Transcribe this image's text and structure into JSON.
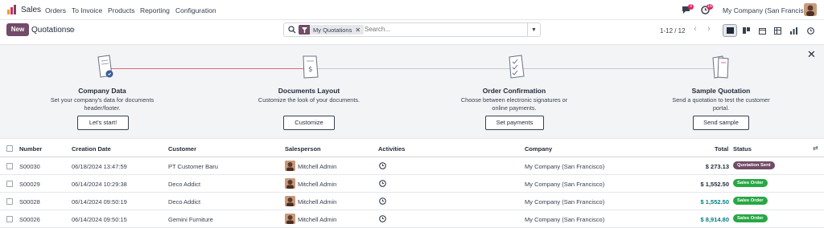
{
  "navbar": {
    "app_name": "Sales",
    "menu": [
      "Orders",
      "To Invoice",
      "Products",
      "Reporting",
      "Configuration"
    ],
    "chat_count": "9",
    "activity_count": "16",
    "company": "My Company (San Francisco)"
  },
  "control": {
    "new_label": "New",
    "title": "Quotations",
    "facet_label": "My Quotations",
    "search_placeholder": "Search...",
    "pager": "1-12 / 12"
  },
  "onboarding": {
    "steps": [
      {
        "title": "Company Data",
        "desc": "Set your company's data for documents header/footer.",
        "button": "Let's start!"
      },
      {
        "title": "Documents Layout",
        "desc": "Customize the look of your documents.",
        "button": "Customize"
      },
      {
        "title": "Order Confirmation",
        "desc": "Choose between electronic signatures or online payments.",
        "button": "Set payments"
      },
      {
        "title": "Sample Quotation",
        "desc": "Send a quotation to test the customer portal.",
        "button": "Send sample"
      }
    ]
  },
  "table": {
    "headers": {
      "number": "Number",
      "creation_date": "Creation Date",
      "customer": "Customer",
      "salesperson": "Salesperson",
      "activities": "Activities",
      "company": "Company",
      "total": "Total",
      "status": "Status"
    },
    "rows": [
      {
        "number": "S00030",
        "date": "06/18/2024 13:47:59",
        "customer": "PT Customer Baru",
        "salesperson": "Mitchell Admin",
        "company": "My Company (San Francisco)",
        "total": "$ 273.13",
        "status": "Quotation Sent"
      },
      {
        "number": "S00029",
        "date": "06/14/2024 10:29:38",
        "customer": "Deco Addict",
        "salesperson": "Mitchell Admin",
        "company": "My Company (San Francisco)",
        "total": "$ 1,552.50",
        "status": "Sales Order"
      },
      {
        "number": "S00028",
        "date": "06/14/2024 09:50:19",
        "customer": "Deco Addict",
        "salesperson": "Mitchell Admin",
        "company": "My Company (San Francisco)",
        "total": "$ 1,552.50",
        "status": "Sales Order"
      },
      {
        "number": "S00026",
        "date": "06/14/2024 09:50:15",
        "customer": "Gemini Furniture",
        "salesperson": "Mitchell Admin",
        "company": "My Company (San Francisco)",
        "total": "$ 8,914.80",
        "status": "Sales Order"
      }
    ]
  },
  "colors": {
    "brand": "#714b67",
    "quotation_sent": "#714b67",
    "sales_order": "#28a745",
    "total_highlight": "#017e84",
    "badge": "#e0245e"
  },
  "icons": {
    "app": "sales-logo-icon",
    "chat": "chat-icon",
    "activity": "clock-icon",
    "views": [
      "list-view-icon",
      "kanban-view-icon",
      "calendar-view-icon",
      "pivot-view-icon",
      "graph-view-icon",
      "activity-view-icon"
    ]
  }
}
